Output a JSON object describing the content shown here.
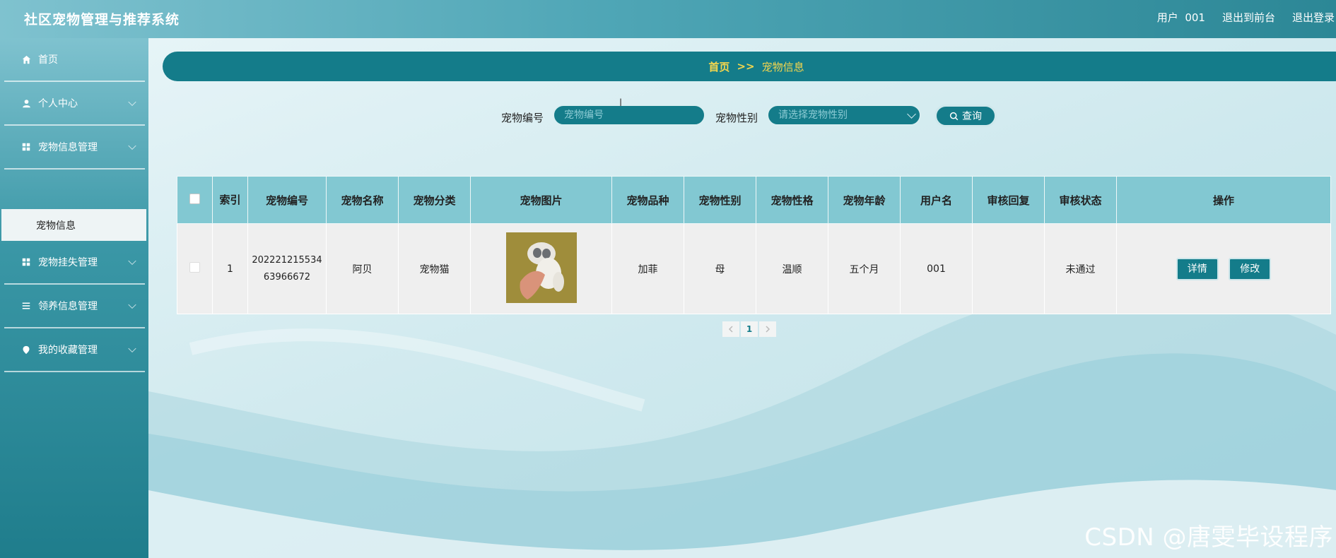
{
  "header": {
    "app_title": "社区宠物管理与推荐系统",
    "user_label": "用户",
    "username": "001",
    "back_to_front": "退出到前台",
    "logout": "退出登录"
  },
  "sidebar": {
    "items": [
      {
        "label": "首页",
        "icon": "home-icon"
      },
      {
        "label": "个人中心",
        "icon": "user-icon"
      },
      {
        "label": "宠物信息管理",
        "icon": "grid-icon"
      },
      {
        "label": "宠物挂失管理",
        "icon": "grid-icon"
      },
      {
        "label": "领养信息管理",
        "icon": "list-icon"
      },
      {
        "label": "我的收藏管理",
        "icon": "pin-icon"
      }
    ],
    "active_sub": "宠物信息"
  },
  "breadcrumb": {
    "home": "首页",
    "separator": ">>",
    "current": "宠物信息"
  },
  "search": {
    "pet_id_label": "宠物编号",
    "pet_id_placeholder": "宠物编号",
    "pet_gender_label": "宠物性别",
    "pet_gender_placeholder": "请选择宠物性别",
    "query_label": "查询"
  },
  "table": {
    "headers": [
      "索引",
      "宠物编号",
      "宠物名称",
      "宠物分类",
      "宠物图片",
      "宠物品种",
      "宠物性别",
      "宠物性格",
      "宠物年龄",
      "用户名",
      "审核回复",
      "审核状态",
      "操作"
    ],
    "rows": [
      {
        "index": "1",
        "pet_id": "20222121553463966672",
        "pet_id_line1": "202221215534",
        "pet_id_line2": "63966672",
        "name": "阿贝",
        "category": "宠物猫",
        "breed": "加菲",
        "gender": "母",
        "temperament": "温顺",
        "age": "五个月",
        "username": "001",
        "review_reply": "",
        "review_status": "未通过",
        "detail_label": "详情",
        "edit_label": "修改"
      }
    ]
  },
  "pagination": {
    "current_page": "1"
  },
  "watermark": "CSDN @唐雯毕设程序",
  "colors": {
    "primary": "#147c8a",
    "header_bg": "#82c8d2",
    "accent": "#f5d64d"
  }
}
